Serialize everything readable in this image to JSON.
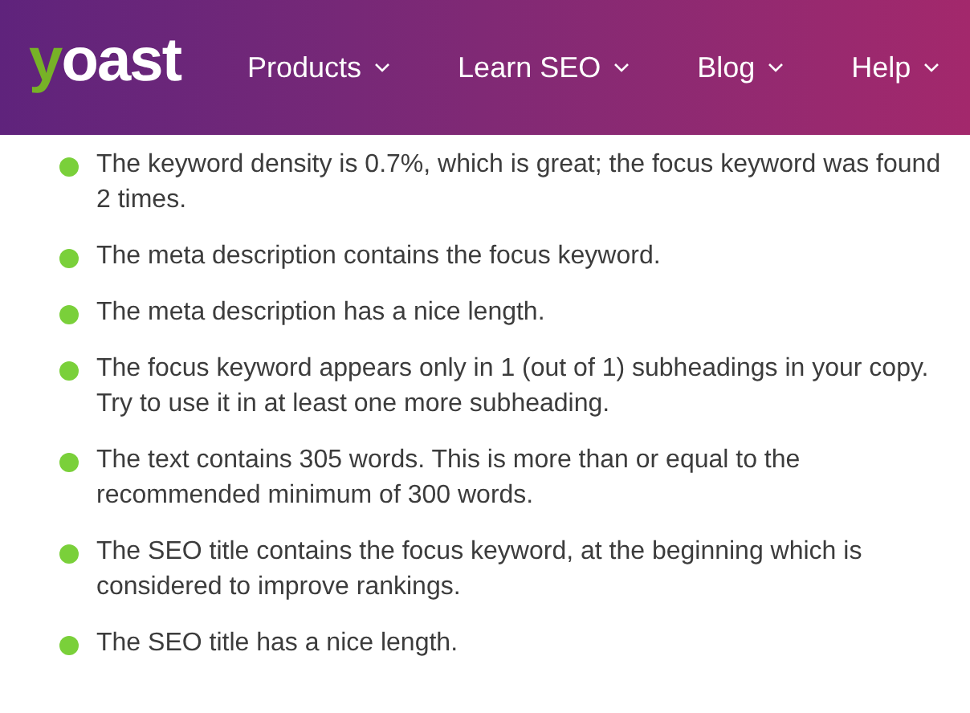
{
  "header": {
    "logo": "yoast",
    "nav": [
      {
        "label": "Products"
      },
      {
        "label": "Learn SEO"
      },
      {
        "label": "Blog"
      },
      {
        "label": "Help"
      }
    ]
  },
  "results": [
    {
      "text": "The keyword density is 0.7%, which is great; the focus keyword was found 2 times.",
      "color": "#7ad03a"
    },
    {
      "text": "The meta description contains the focus keyword.",
      "color": "#7ad03a"
    },
    {
      "text": "The meta description has a nice length.",
      "color": "#7ad03a"
    },
    {
      "text": "The focus keyword appears only in 1 (out of 1) subheadings in your copy. Try to use it in at least one more subheading.",
      "color": "#7ad03a"
    },
    {
      "text": "The text contains 305 words. This is more than or equal to the recommended minimum of 300 words.",
      "color": "#7ad03a"
    },
    {
      "text": "The SEO title contains the focus keyword, at the beginning which is considered to improve rankings.",
      "color": "#7ad03a"
    },
    {
      "text": "The SEO title has a nice length.",
      "color": "#7ad03a"
    }
  ]
}
